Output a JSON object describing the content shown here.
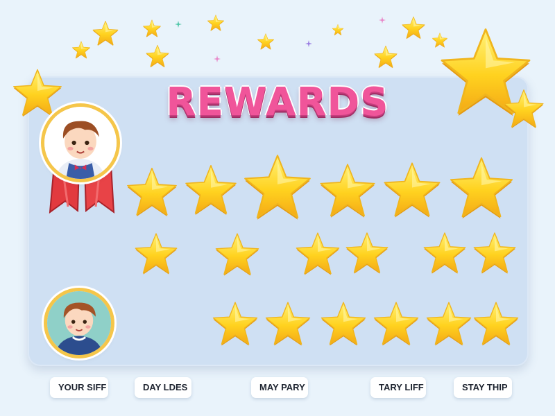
{
  "title": "REWARDS",
  "labels": [
    "YOUR SIFF",
    "DAY LDES",
    "MAY PARY",
    "TARY LIFF",
    "STAY THIP"
  ],
  "colors": {
    "title": "#f0559a",
    "star": "#ffd21f",
    "board": "#cfe0f3",
    "ribbon": "#e23a3f",
    "avatar_frame": "#f5c64a"
  },
  "icons": {
    "star": "star-icon",
    "avatar": "child-avatar-icon",
    "ribbon": "award-ribbon-icon"
  }
}
